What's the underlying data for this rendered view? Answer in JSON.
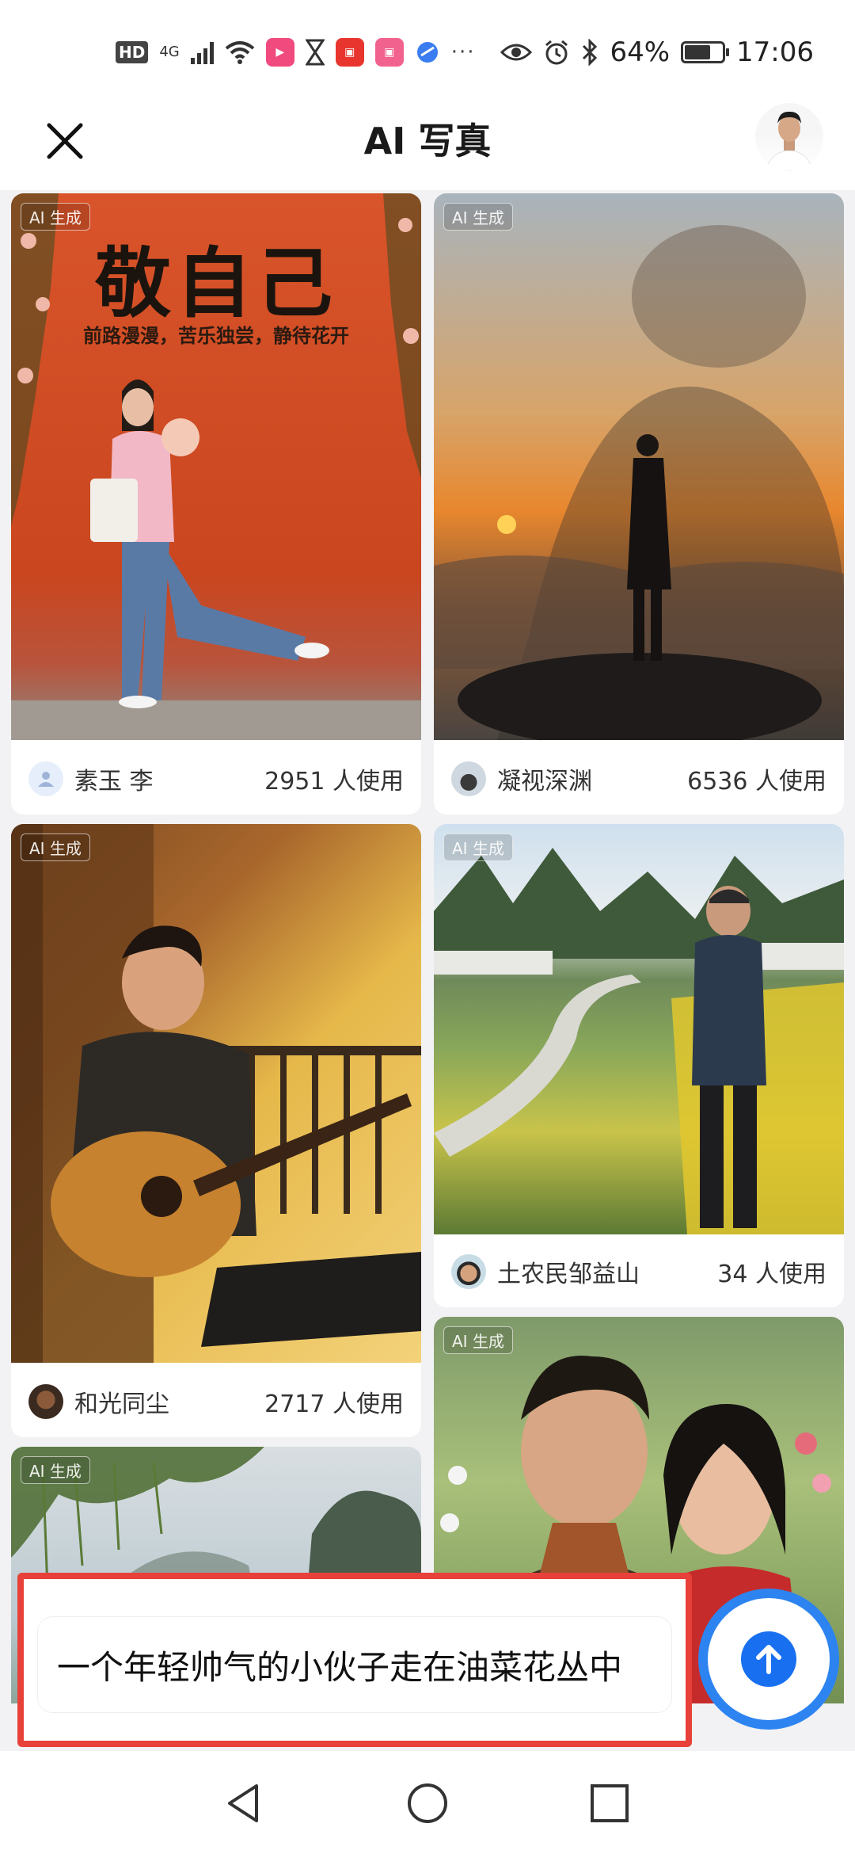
{
  "status_bar": {
    "hd": "HD",
    "network": "4G",
    "battery": "64%",
    "battery_level": 0.64,
    "time": "17:06",
    "more": "···"
  },
  "header": {
    "title": "AI 写真"
  },
  "tag": "AI 生成",
  "poster": {
    "title": "敬自己",
    "subtitle": "前路漫漫，苦乐独尝，静待花开"
  },
  "cards": [
    {
      "user": "素玉 李",
      "uses": "2951 人使用"
    },
    {
      "user": "凝视深渊",
      "uses": "6536 人使用"
    },
    {
      "user": "和光同尘",
      "uses": "2717 人使用"
    },
    {
      "user": "土农民邹益山",
      "uses": "34 人使用"
    }
  ],
  "input": {
    "value": "一个年轻帅气的小伙子走在油菜花丛中"
  },
  "colors": {
    "accent": "#1870f0",
    "highlight": "#e8413a"
  }
}
